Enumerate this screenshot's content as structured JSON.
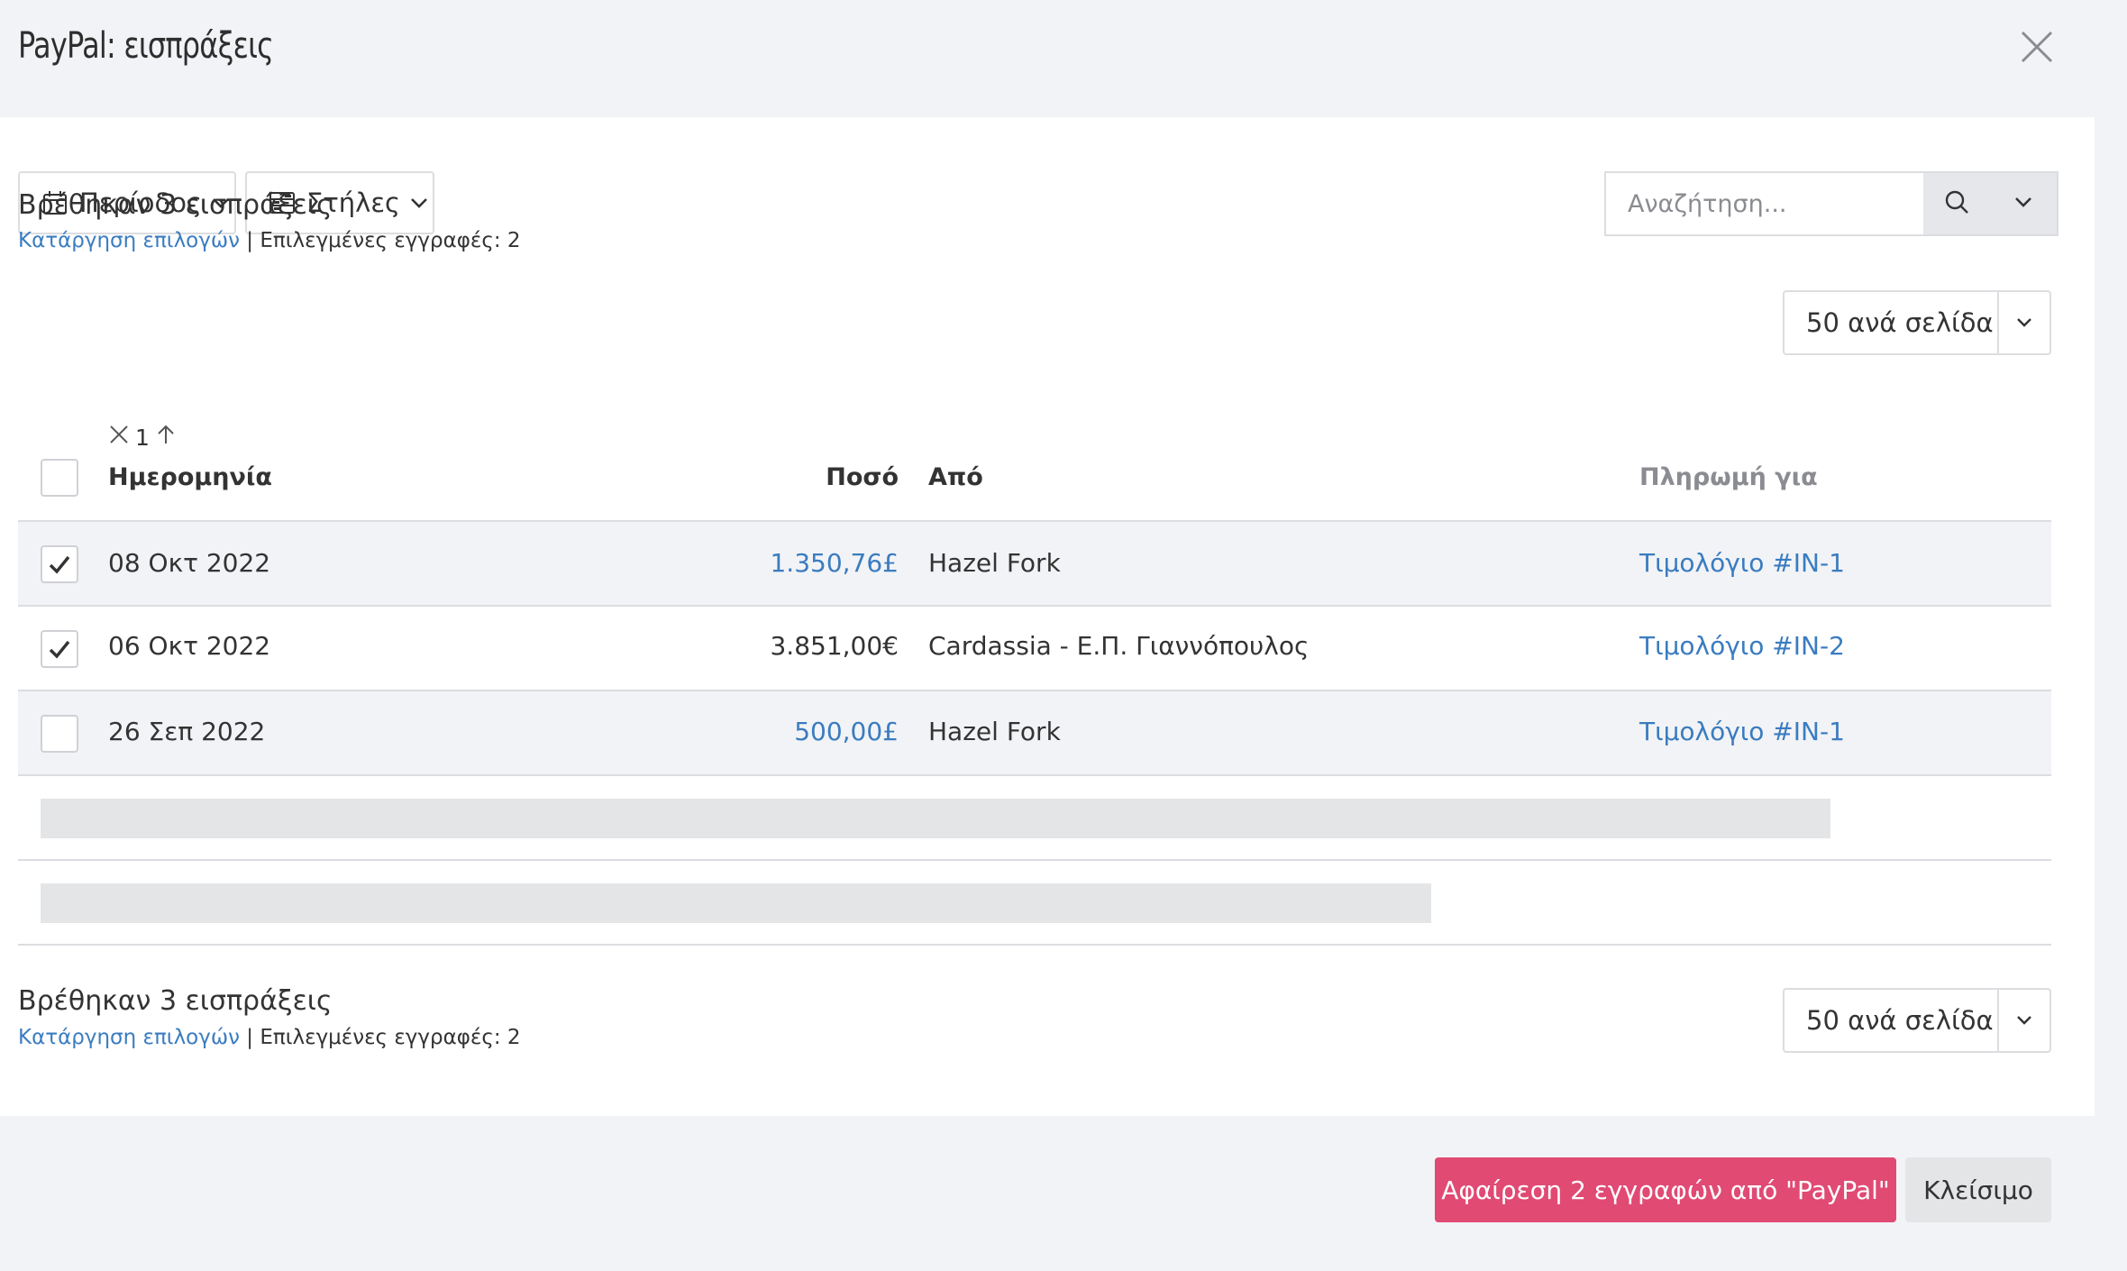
{
  "modal": {
    "title": "PayPal: εισπράξεις"
  },
  "toolbar": {
    "period_label": "Περίοδος",
    "columns_label": "Στήλες",
    "search_placeholder": "Αναζήτηση..."
  },
  "summary_top": {
    "found_text": "Βρέθηκαν 3 εισπράξεις",
    "clear_selection": "Κατάργηση επιλογών",
    "separator": " | ",
    "selected_text": "Επιλεγμένες εγγραφές: 2",
    "per_page": "50 ανά σελίδα"
  },
  "table": {
    "sort_indicator": "1",
    "headers": {
      "date": "Ημερομηνία",
      "amount": "Ποσό",
      "from": "Από",
      "payment_for": "Πληρωμή για"
    },
    "rows": [
      {
        "checked": true,
        "date": "08 Οκτ 2022",
        "amount": "1.350,76£",
        "from": "Hazel Fork",
        "payment_for": "Τιμολόγιο #IN-1"
      },
      {
        "checked": true,
        "date": "06 Οκτ 2022",
        "amount": "3.851,00€",
        "from": "Cardassia - Ε.Π. Γιαννόπουλος",
        "payment_for": "Τιμολόγιο #IN-2"
      },
      {
        "checked": false,
        "date": "26 Σεπ 2022",
        "amount": "500,00£",
        "from": "Hazel Fork",
        "payment_for": "Τιμολόγιο #IN-1"
      }
    ]
  },
  "summary_bottom": {
    "found_text": "Βρέθηκαν 3 εισπράξεις",
    "clear_selection": "Κατάργηση επιλογών",
    "separator": " | ",
    "selected_text": "Επιλεγμένες εγγραφές: 2",
    "per_page": "50 ανά σελίδα"
  },
  "footer": {
    "remove_label": "Αφαίρεση 2 εγγραφών από \"PayPal\"",
    "close_label": "Κλείσιμο"
  },
  "colors": {
    "link": "#3a7cc0",
    "danger": "#e04a73",
    "background": "#f2f3f6"
  }
}
